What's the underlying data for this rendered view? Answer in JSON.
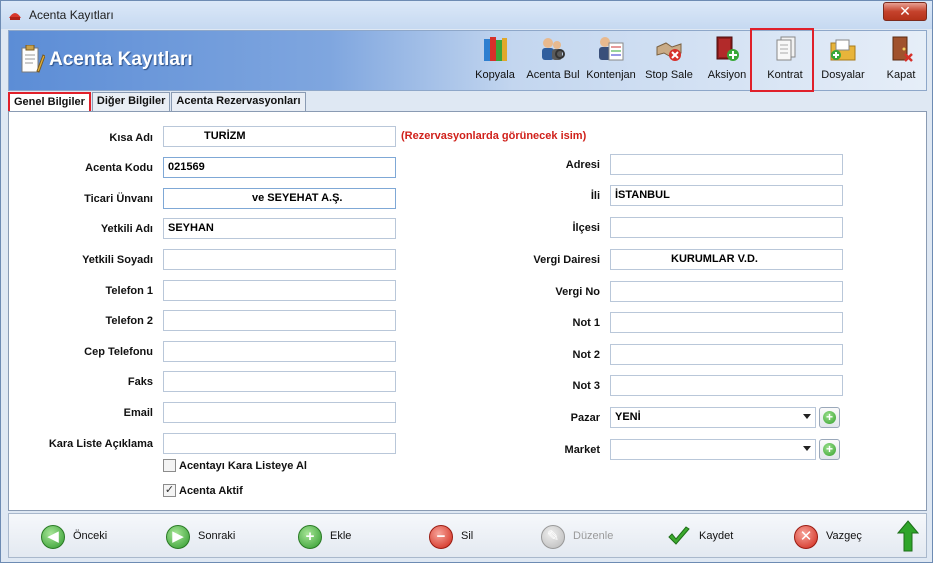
{
  "window": {
    "title": "Acenta Kayıtları"
  },
  "header": {
    "title": "Acenta Kayıtları"
  },
  "toolbar": [
    {
      "label": "Kopyala",
      "icon": "books-icon"
    },
    {
      "label": "Acenta Bul",
      "icon": "search-users-icon"
    },
    {
      "label": "Kontenjan",
      "icon": "quota-icon"
    },
    {
      "label": "Stop Sale",
      "icon": "stop-sale-icon"
    },
    {
      "label": "Aksiyon",
      "icon": "action-book-icon"
    },
    {
      "label": "Kontrat",
      "icon": "contract-icon"
    },
    {
      "label": "Dosyalar",
      "icon": "folder-icon"
    },
    {
      "label": "Kapat",
      "icon": "exit-door-icon"
    }
  ],
  "tabs": [
    "Genel Bilgiler",
    "Diğer Bilgiler",
    "Acenta Rezervasyonları"
  ],
  "form_left": {
    "kisa_adi": {
      "label": "Kısa Adı",
      "value": "TURİZM"
    },
    "hint": "(Rezervasyonlarda görünecek isim)",
    "acenta_kodu": {
      "label": "Acenta Kodu",
      "value": "021569"
    },
    "ticari_unvani": {
      "label": "Ticari Ünvanı",
      "value": "ve SEYEHAT A.Ş."
    },
    "yetkili_adi": {
      "label": "Yetkili Adı",
      "value": "SEYHAN"
    },
    "yetkili_soyadi": {
      "label": "Yetkili Soyadı",
      "value": ""
    },
    "telefon1": {
      "label": "Telefon 1",
      "value": ""
    },
    "telefon2": {
      "label": "Telefon 2",
      "value": ""
    },
    "cep_telefonu": {
      "label": "Cep Telefonu",
      "value": ""
    },
    "faks": {
      "label": "Faks",
      "value": ""
    },
    "email": {
      "label": "Email",
      "value": ""
    },
    "kara_liste": {
      "label": "Kara Liste Açıklama",
      "value": ""
    },
    "chk_kara_liste": {
      "label": "Acentayı Kara Listeye Al",
      "checked": false
    },
    "chk_aktif": {
      "label": "Acenta Aktif",
      "checked": true
    }
  },
  "form_right": {
    "adresi": {
      "label": "Adresi",
      "value": ""
    },
    "ili": {
      "label": "İli",
      "value": "İSTANBUL"
    },
    "ilcesi": {
      "label": "İlçesi",
      "value": ""
    },
    "vergi_dairesi": {
      "label": "Vergi Dairesi",
      "value": "KURUMLAR V.D."
    },
    "vergi_no": {
      "label": "Vergi No",
      "value": ""
    },
    "not1": {
      "label": "Not 1",
      "value": ""
    },
    "not2": {
      "label": "Not 2",
      "value": ""
    },
    "not3": {
      "label": "Not 3",
      "value": ""
    },
    "pazar": {
      "label": "Pazar",
      "value": "YENİ"
    },
    "market": {
      "label": "Market",
      "value": ""
    }
  },
  "bottom": {
    "onceki": "Önceki",
    "sonraki": "Sonraki",
    "ekle": "Ekle",
    "sil": "Sil",
    "duzenle": "Düzenle",
    "kaydet": "Kaydet",
    "vazgec": "Vazgeç"
  },
  "colors": {
    "accent_red": "#e0202a",
    "header_blue": "#5c8dd6",
    "hint_red": "#d0201a"
  }
}
